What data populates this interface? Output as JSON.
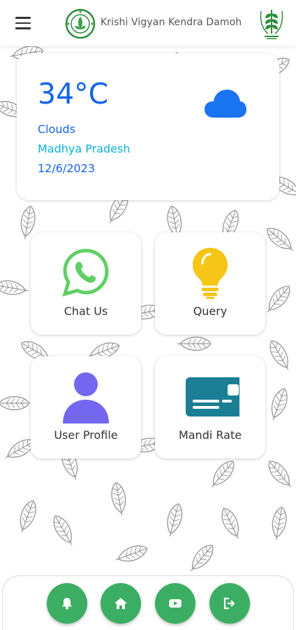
{
  "header": {
    "title": "Krishi Vigyan Kendra Damoh",
    "menu_icon": "hamburger-menu-icon",
    "left_logo": "kvk-emblem-logo",
    "right_logo": "icar-wheat-logo"
  },
  "weather": {
    "temperature": "34°C",
    "condition": "Clouds",
    "location": "Madhya Pradesh",
    "date": "12/6/2023",
    "icon": "cloud-icon",
    "colors": {
      "primary": "#1565e5",
      "location": "#0bb4d9",
      "cloud": "#1a73f0"
    }
  },
  "tiles": [
    {
      "label": "Chat Us",
      "icon": "whatsapp-icon",
      "color": "#5fcf64"
    },
    {
      "label": "Query",
      "icon": "lightbulb-icon",
      "color": "#f5c518"
    },
    {
      "label": "User Profile",
      "icon": "user-icon",
      "color": "#7367f0"
    },
    {
      "label": "Mandi Rate",
      "icon": "card-icon",
      "color": "#1a7f95"
    }
  ],
  "bottom_nav": {
    "accent": "#3cae63",
    "items": [
      {
        "icon": "bell-icon"
      },
      {
        "icon": "home-icon"
      },
      {
        "icon": "youtube-icon"
      },
      {
        "icon": "logout-icon"
      }
    ]
  }
}
